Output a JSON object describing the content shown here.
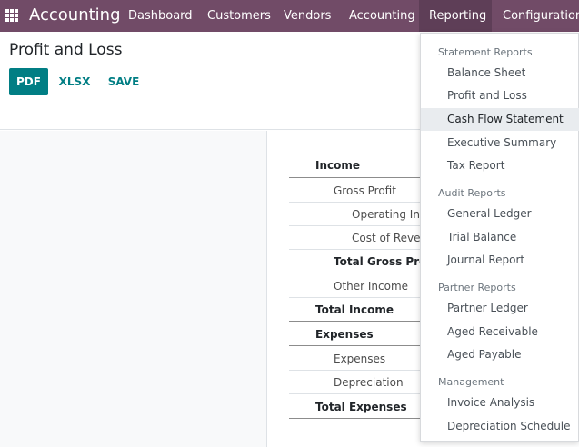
{
  "navbar": {
    "brand": "Accounting",
    "items": [
      {
        "label": "Dashboard"
      },
      {
        "label": "Customers"
      },
      {
        "label": "Vendors"
      },
      {
        "label": "Accounting"
      },
      {
        "label": "Reporting"
      },
      {
        "label": "Configuration"
      }
    ],
    "active_item": "Reporting",
    "bg_color": "#714b67"
  },
  "control_panel": {
    "title": "Profit and Loss",
    "buttons": {
      "pdf": "PDF",
      "xlsx": "XLSX",
      "save": "SAVE"
    },
    "accent_color": "#017e84"
  },
  "report": {
    "rows": [
      {
        "label": "Income",
        "level": 0,
        "bold": true
      },
      {
        "label": "Gross Profit",
        "level": 1,
        "bold": false
      },
      {
        "label": "Operating Inc",
        "level": 2,
        "bold": false
      },
      {
        "label": "Cost of Rever",
        "level": 2,
        "bold": false
      },
      {
        "label": "Total Gross Prof",
        "level": 1,
        "bold": true
      },
      {
        "label": "Other Income",
        "level": 1,
        "bold": false
      },
      {
        "label": "Total Income",
        "level": 0,
        "bold": true
      },
      {
        "label": "Expenses",
        "level": 0,
        "bold": true
      },
      {
        "label": "Expenses",
        "level": 1,
        "bold": false
      },
      {
        "label": "Depreciation",
        "level": 1,
        "bold": false
      },
      {
        "label": "Total Expenses",
        "level": 0,
        "bold": true
      }
    ]
  },
  "reporting_menu": {
    "sections": [
      {
        "header": "Statement Reports",
        "items": [
          "Balance Sheet",
          "Profit and Loss",
          "Cash Flow Statement",
          "Executive Summary",
          "Tax Report"
        ]
      },
      {
        "header": "Audit Reports",
        "items": [
          "General Ledger",
          "Trial Balance",
          "Journal Report"
        ]
      },
      {
        "header": "Partner Reports",
        "items": [
          "Partner Ledger",
          "Aged Receivable",
          "Aged Payable"
        ]
      },
      {
        "header": "Management",
        "items": [
          "Invoice Analysis",
          "Depreciation Schedule"
        ]
      }
    ],
    "hovered_item": "Cash Flow Statement"
  }
}
